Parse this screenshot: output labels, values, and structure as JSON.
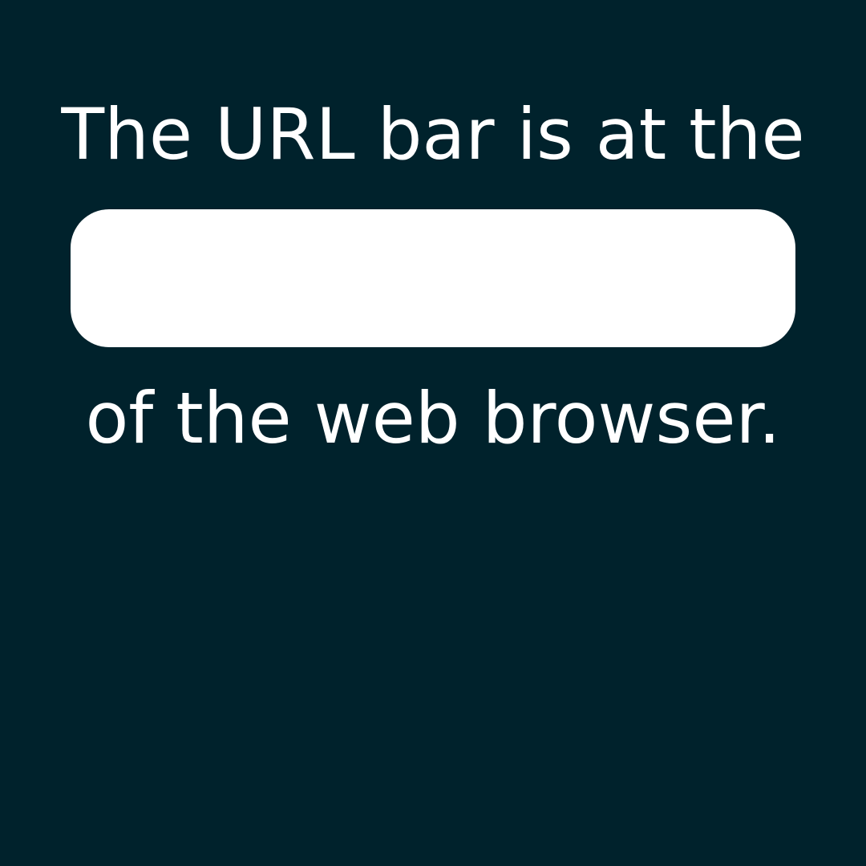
{
  "prompt": {
    "line_1": "The URL bar is at the",
    "line_2": "of the web browser."
  },
  "colors": {
    "background": "#00222c",
    "text": "#ffffff",
    "blank": "#ffffff"
  }
}
